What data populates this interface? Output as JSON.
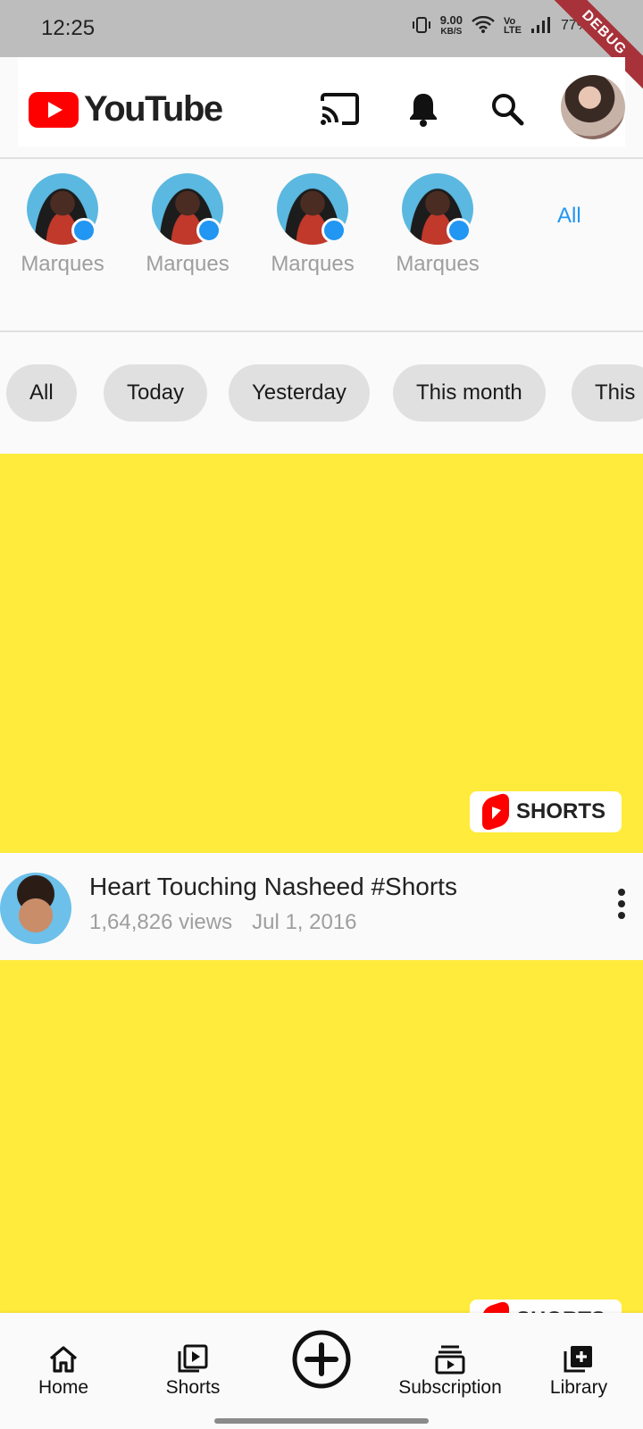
{
  "status_bar": {
    "time": "12:25",
    "speed_value": "9.00",
    "speed_unit": "KB/S",
    "battery": "77%",
    "debug_banner": "DEBUG"
  },
  "app_bar": {
    "logo_text": "YouTube",
    "icons": [
      "cast-icon",
      "notifications-icon",
      "search-icon",
      "account-avatar"
    ]
  },
  "subscriptions": {
    "channels": [
      {
        "name": "Marques"
      },
      {
        "name": "Marques"
      },
      {
        "name": "Marques"
      },
      {
        "name": "Marques"
      }
    ],
    "all_label": "All"
  },
  "filters": [
    "All",
    "Today",
    "Yesterday",
    "This month",
    "This"
  ],
  "feed": {
    "items": [
      {
        "badge": "SHORTS",
        "title": "Heart Touching Nasheed #Shorts",
        "views": "1,64,826 views",
        "date": "Jul 1, 2016"
      },
      {
        "badge": "SHORTS"
      }
    ]
  },
  "bottom_nav": {
    "items": [
      {
        "label": "Home",
        "icon": "home-icon"
      },
      {
        "label": "Shorts",
        "icon": "shorts-icon"
      },
      {
        "label": "",
        "icon": "create-icon"
      },
      {
        "label": "Subscription",
        "icon": "subscriptions-icon"
      },
      {
        "label": "Library",
        "icon": "library-icon"
      }
    ]
  },
  "colors": {
    "youtube_red": "#ff0000",
    "thumbnail_yellow": "#ffeb3b",
    "accent_blue": "#2196f3",
    "status_bar_gray": "#bdbdbd"
  }
}
